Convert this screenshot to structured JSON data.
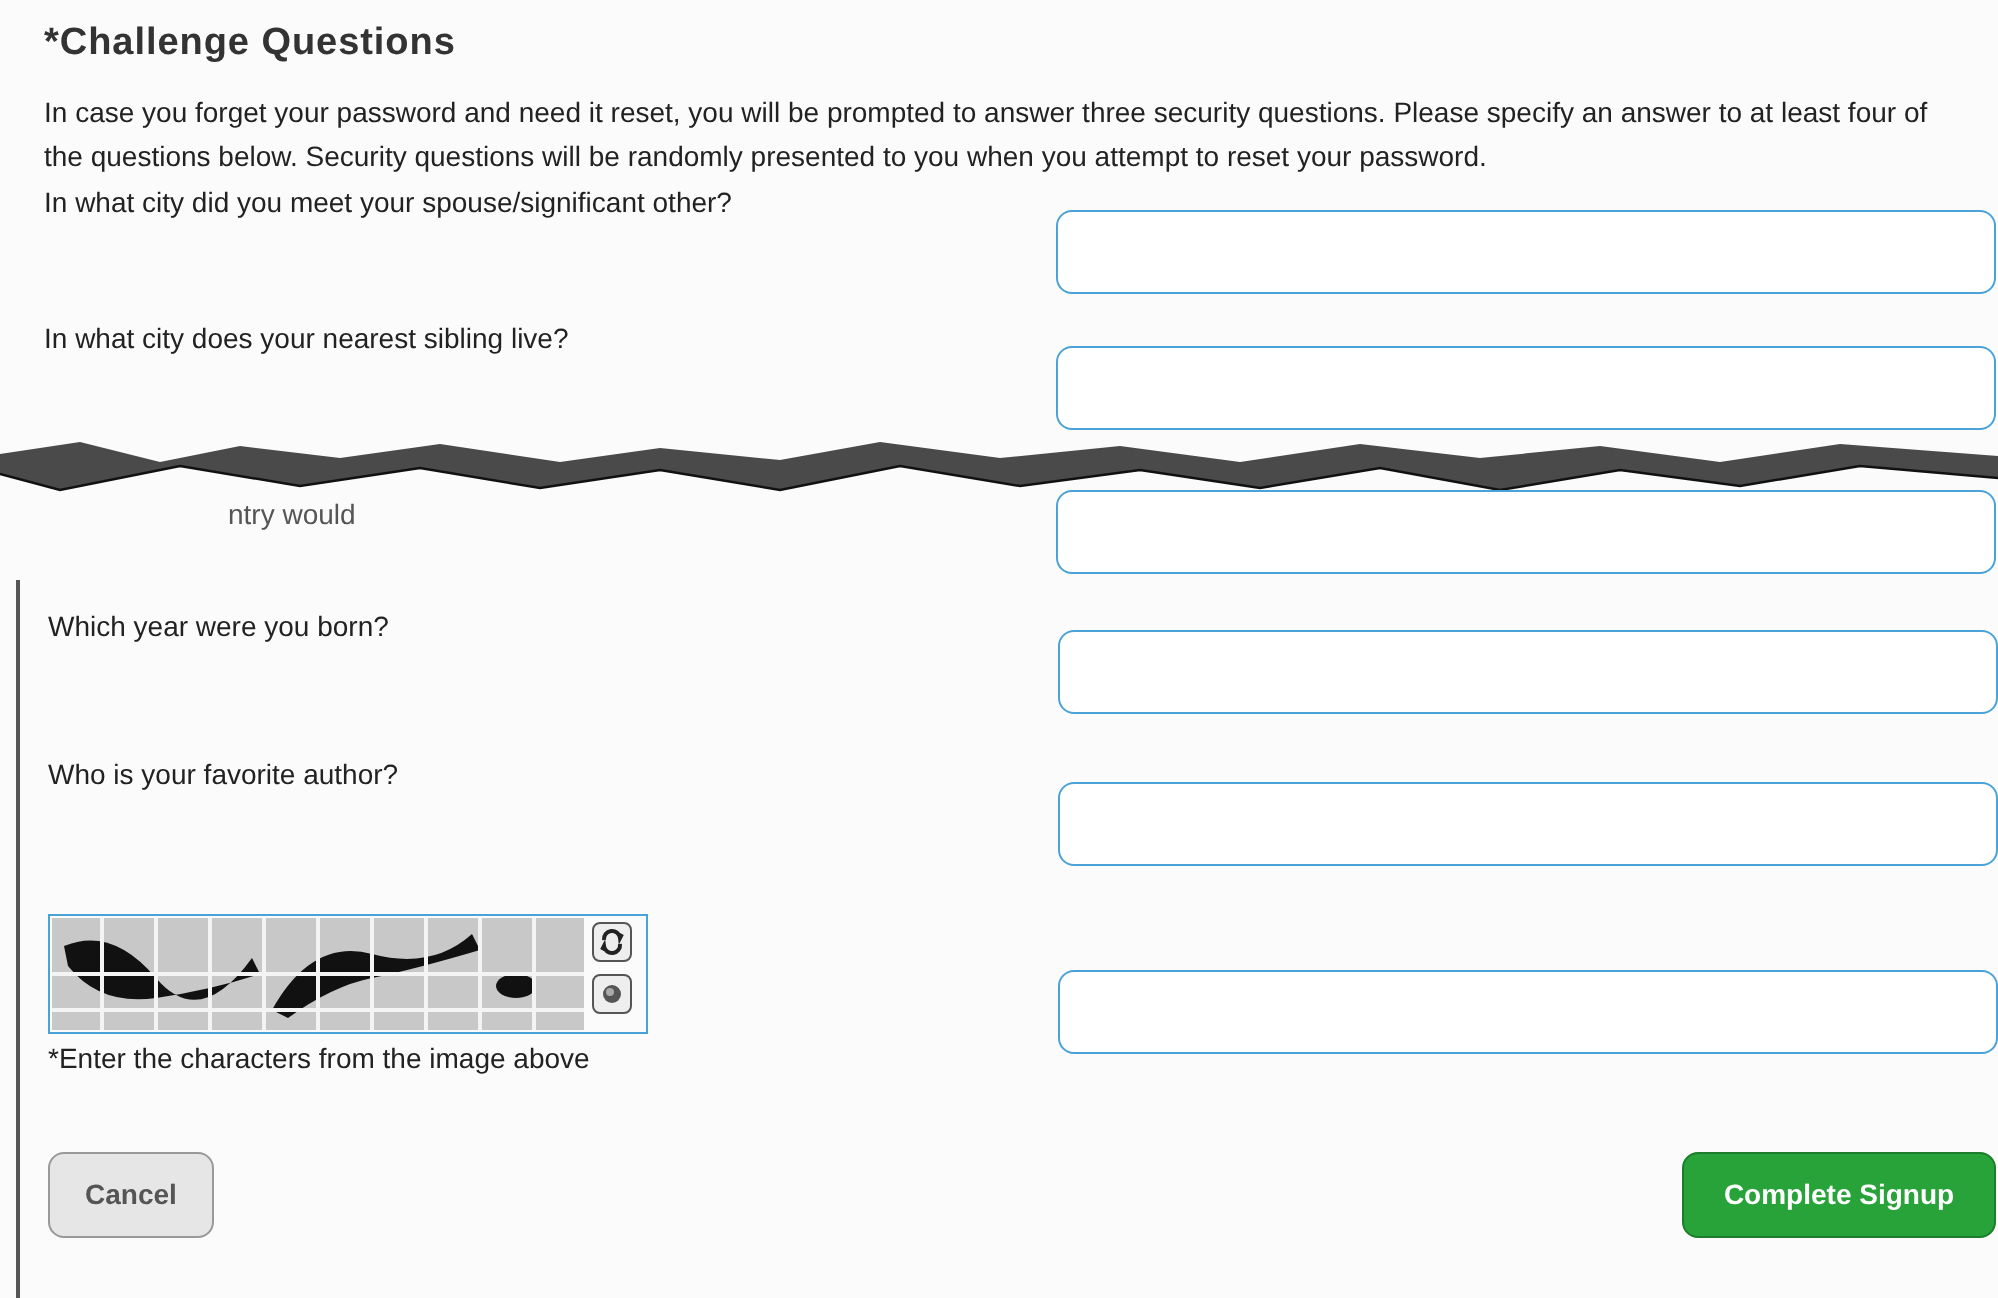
{
  "title": "*Challenge Questions",
  "intro": "In case you forget your password and need it reset, you will be prompted to answer three security questions. Please specify an answer to at least four of the questions below. Security questions will be randomly presented to you when you attempt to reset your password.",
  "questions_top": [
    {
      "label": "In what city did you meet your spouse/significant other?"
    },
    {
      "label": "In what city does your nearest sibling live?"
    }
  ],
  "torn_fragment": "ntry would",
  "questions_bottom": [
    {
      "label": "Which year were you born?"
    },
    {
      "label": "Who is your favorite author?"
    }
  ],
  "captcha": {
    "kind": "picture",
    "hint": "*Enter the characters from the image above"
  },
  "buttons": {
    "cancel": "Cancel",
    "submit": "Complete Signup"
  }
}
